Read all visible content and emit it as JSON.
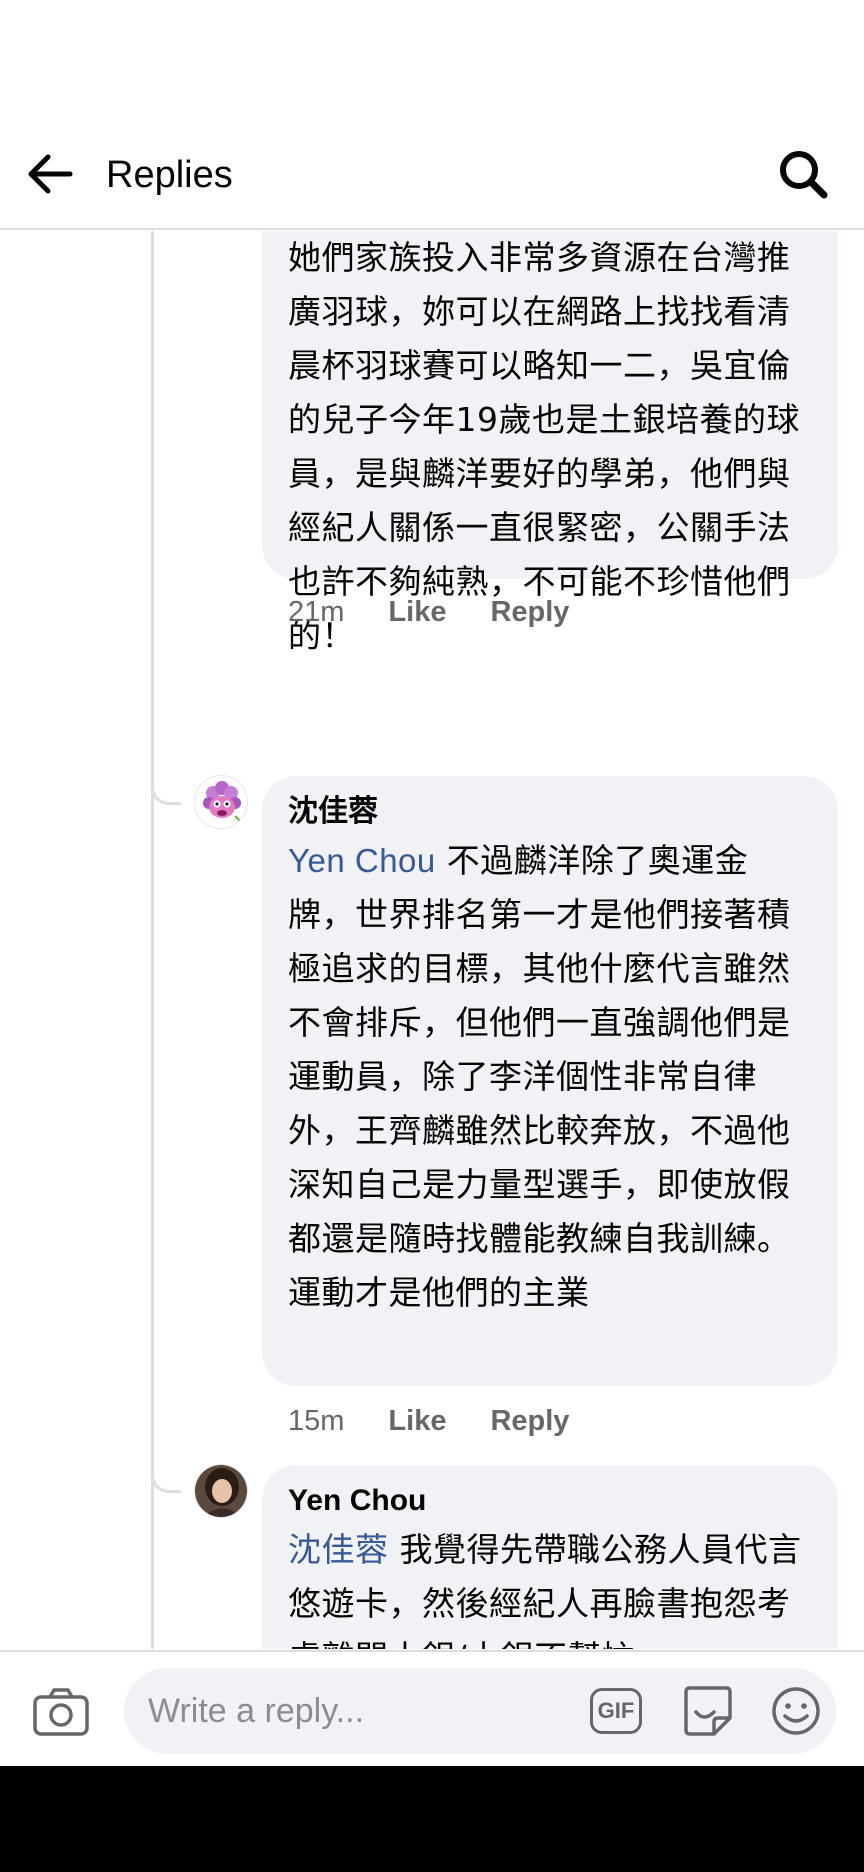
{
  "header": {
    "title": "Replies",
    "back_icon": "arrow-left-icon",
    "search_icon": "search-icon"
  },
  "comments": [
    {
      "author": "",
      "mention": "",
      "text": "王家麟洋他們的經紀人吳宜倫\n她們家族投入非常多資源在台灣推廣羽球，妳可以在網路上找找看清晨杯羽球賽可以略知一二，吳宜倫的兒子今年19歲也是土銀培養的球員，是與麟洋要好的學弟，他們與經紀人關係一直很緊密，公關手法也許不夠純熟，不可能不珍惜他們的！",
      "time": "21m",
      "like_label": "Like",
      "reply_label": "Reply"
    },
    {
      "author": "沈佳蓉",
      "mention": "Yen Chou",
      "text": " 不過麟洋除了奧運金牌，世界排名第一才是他們接著積極追求的目標，其他什麼代言雖然不會排斥，但他們一直強調他們是運動員，除了李洋個性非常自律外，王齊麟雖然比較奔放，不過他深知自己是力量型選手，即使放假都還是隨時找體能教練自我訓練。運動才是他們的主業",
      "time": "15m",
      "like_label": "Like",
      "reply_label": "Reply",
      "avatar_icon": "cartoon-avatar-icon"
    },
    {
      "author": "Yen Chou",
      "mention": "沈佳蓉",
      "text": " 我覺得先帶職公務人員代言悠遊卡，然後經紀人再臉書抱怨考慮離開土銀/土銀不幫忙",
      "avatar_icon": "profile-photo-icon"
    }
  ],
  "composer": {
    "placeholder": "Write a reply...",
    "camera_icon": "camera-icon",
    "gif_label": "GIF",
    "sticker_icon": "sticker-icon",
    "emoji_icon": "smiley-icon"
  },
  "colors": {
    "bubble": "#f0f2f5",
    "mention": "#385898",
    "meta": "#65676b",
    "divider": "#dadde1"
  }
}
